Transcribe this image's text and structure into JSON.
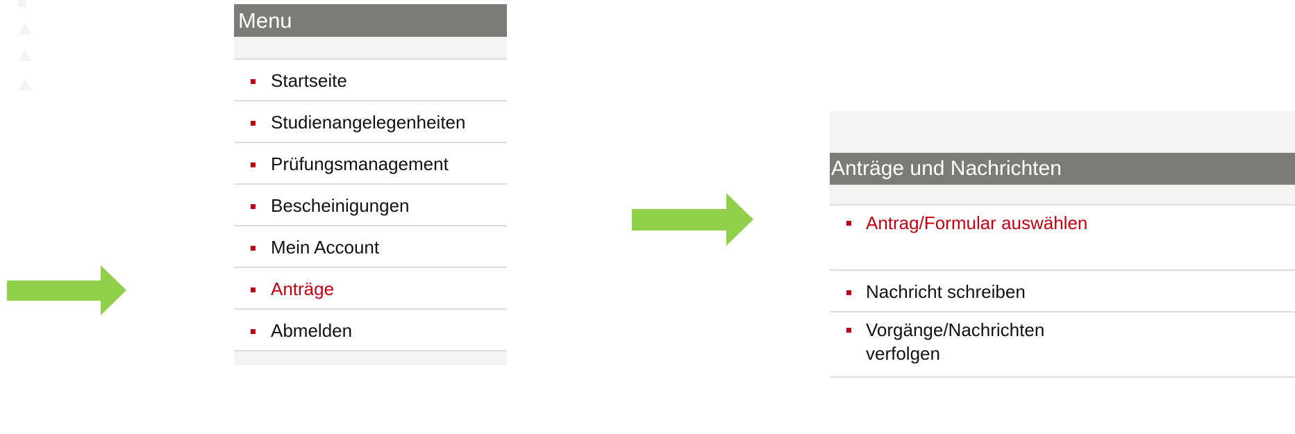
{
  "colors": {
    "arrow": "#8fcf4a",
    "header_background": "#7b7b78",
    "active_text": "#c8000f",
    "bullet": "#c00014"
  },
  "main_menu": {
    "title": "Menu",
    "items": [
      {
        "label": "Startseite",
        "active": false
      },
      {
        "label": "Studienangelegenheiten",
        "active": false
      },
      {
        "label": "Prüfungsmanagement",
        "active": false
      },
      {
        "label": "Bescheinigungen",
        "active": false
      },
      {
        "label": "Mein Account",
        "active": false
      },
      {
        "label": "Anträge",
        "active": true
      },
      {
        "label": "Abmelden",
        "active": false
      }
    ]
  },
  "submenu": {
    "title": "Anträge und Nachrichten",
    "items": [
      {
        "label": "Antrag/Formular auswählen",
        "active": true
      },
      {
        "label": "Nachricht schreiben",
        "active": false
      },
      {
        "label": "Vorgänge/Nachrichten verfolgen",
        "active": false
      }
    ]
  },
  "icons": {
    "arrows": [
      "arrow-right-icon",
      "arrow-right-icon"
    ]
  }
}
